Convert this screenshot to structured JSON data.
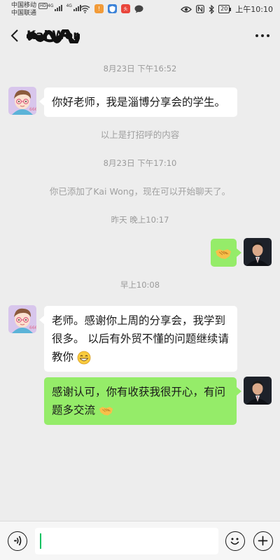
{
  "status_bar": {
    "carrier1": "中国移动",
    "carrier1_badge": "HD",
    "carrier2": "中国联通",
    "net1": "4G",
    "net2": "4G",
    "battery": "20",
    "time": "上午10:10",
    "icons": [
      "signal-icon",
      "wifi-icon",
      "app-notification-icon",
      "security-icon",
      "message-icon",
      "eye-icon",
      "nfc-icon",
      "bluetooth-icon",
      "battery-icon"
    ]
  },
  "header": {
    "contact_name": "Kai Wong",
    "icons": {
      "back": "back-chevron-icon",
      "more": "more-dots-icon"
    }
  },
  "messages": [
    {
      "type": "time",
      "text": "8月23日 下午16:52"
    },
    {
      "type": "bubble",
      "side": "left",
      "text": "你好老师，我是淄博分享会的学生。"
    },
    {
      "type": "system",
      "text": "以上是打招呼的内容"
    },
    {
      "type": "time",
      "text": "8月23日 下午17:10"
    },
    {
      "type": "system",
      "text": "你已添加了Kai Wong，现在可以开始聊天了。"
    },
    {
      "type": "time",
      "text": "昨天 晚上10:17"
    },
    {
      "type": "bubble",
      "side": "right",
      "emoji": "handshake"
    },
    {
      "type": "time",
      "text": "早上10:08"
    },
    {
      "type": "bubble",
      "side": "left",
      "text": "老师。感谢你上周的分享会，我学到很多。 以后有外贸不懂的问题继续请教你",
      "emoji": "grin"
    },
    {
      "type": "bubble",
      "side": "right",
      "text": "感谢认可，你有收获我很开心，有问题多交流",
      "emoji": "handshake"
    }
  ],
  "input_bar": {
    "value": "",
    "icons": {
      "voice": "voice-icon",
      "emoji": "emoji-icon",
      "plus": "plus-icon"
    }
  },
  "colors": {
    "background": "#ededed",
    "bubble_self": "#95ec69",
    "bubble_other": "#ffffff",
    "caret": "#07c160"
  }
}
